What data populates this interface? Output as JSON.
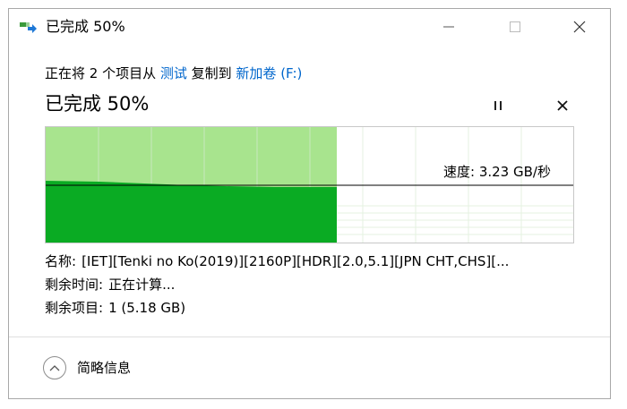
{
  "window": {
    "title": "已完成 50%",
    "minimize_icon": "minimize-icon",
    "maximize_icon": "maximize-icon",
    "close_icon": "close-icon"
  },
  "operation": {
    "prefix": "正在将 2 个项目从 ",
    "source": "测试",
    "middle": " 复制到 ",
    "destination": "新加卷 (F:)"
  },
  "progress": {
    "heading": "已完成 50%",
    "percent": 50
  },
  "graph": {
    "speed_label": "速度: 3.23 GB/秒",
    "colors": {
      "fill_light": "#a8e48e",
      "fill_dark": "#0aab23",
      "grid": "#dcefd8",
      "speed_line": "#000000"
    }
  },
  "details": {
    "name_label": "名称:",
    "name_value": "[IET][Tenki no Ko(2019)][2160P][HDR][2.0,5.1][JPN CHT,CHS][...",
    "time_label": "剩余时间:",
    "time_value": "正在计算...",
    "items_label": "剩余项目:",
    "items_value": "1 (5.18 GB)"
  },
  "footer": {
    "toggle_label": "简略信息",
    "toggle_icon": "chevron-up-icon"
  }
}
